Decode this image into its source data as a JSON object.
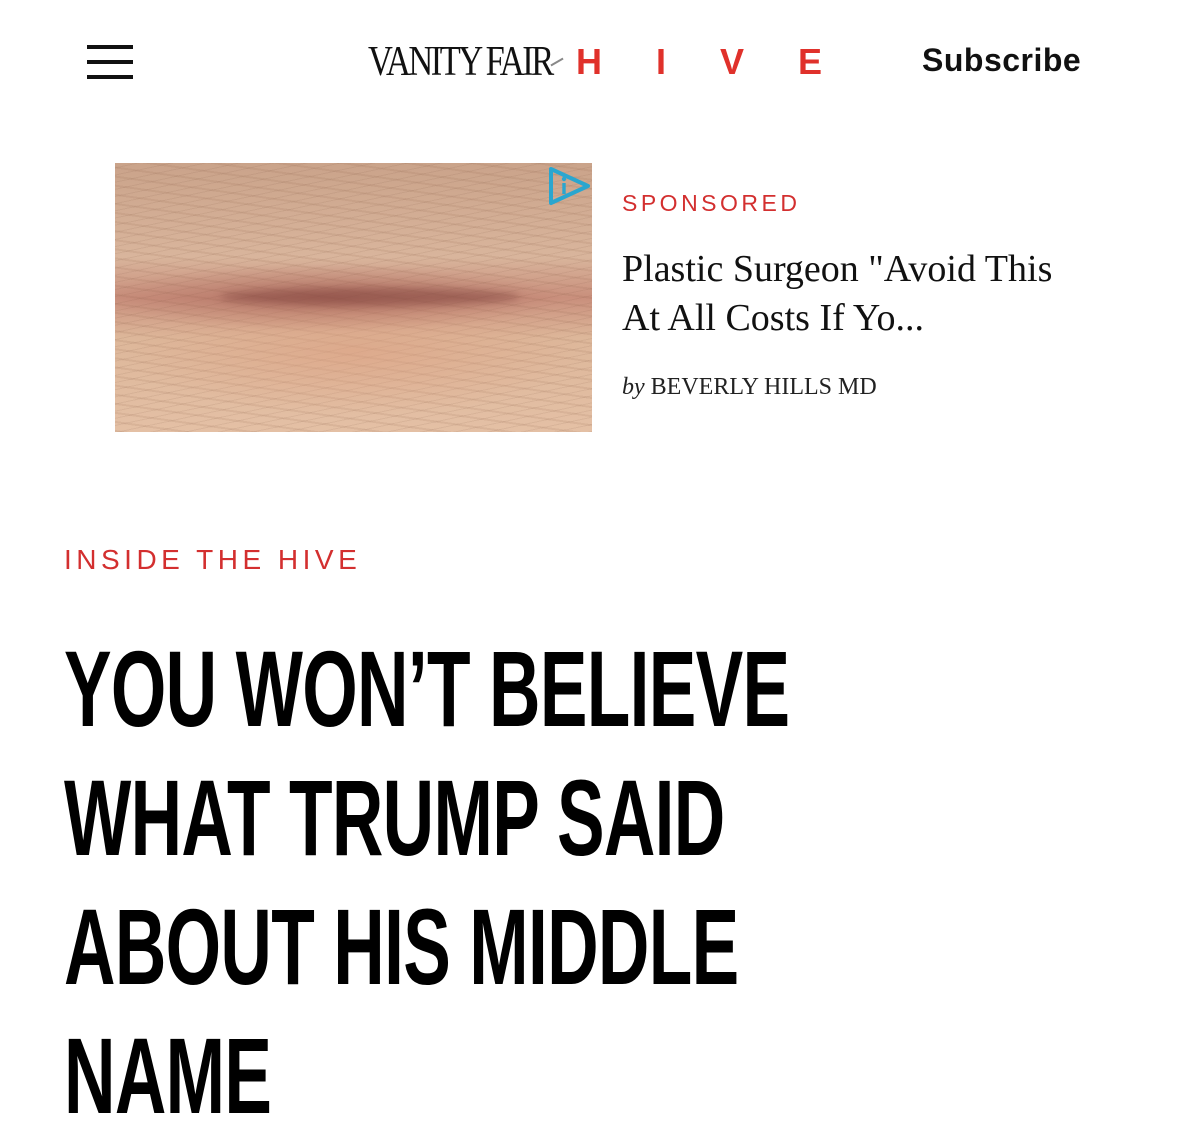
{
  "header": {
    "menu_icon": "hamburger-menu-icon",
    "logo": {
      "brand": "VANITY FAIR",
      "section": "HIVE",
      "section_color": "#e0312b"
    },
    "subscribe_label": "Subscribe"
  },
  "ad": {
    "label": "SPONSORED",
    "title": "Plastic Surgeon \"Avoid This At All Costs If Yo...",
    "by": "by",
    "advertiser": "BEVERLY HILLS MD",
    "ad_choice_icon": "adchoices-icon",
    "label_color": "#d32f2f"
  },
  "article": {
    "kicker": "INSIDE THE HIVE",
    "headline": "YOU WON’T BELIEVE WHAT TRUMP SAID ABOUT HIS MIDDLE NAME",
    "kicker_color": "#d32f2f"
  }
}
